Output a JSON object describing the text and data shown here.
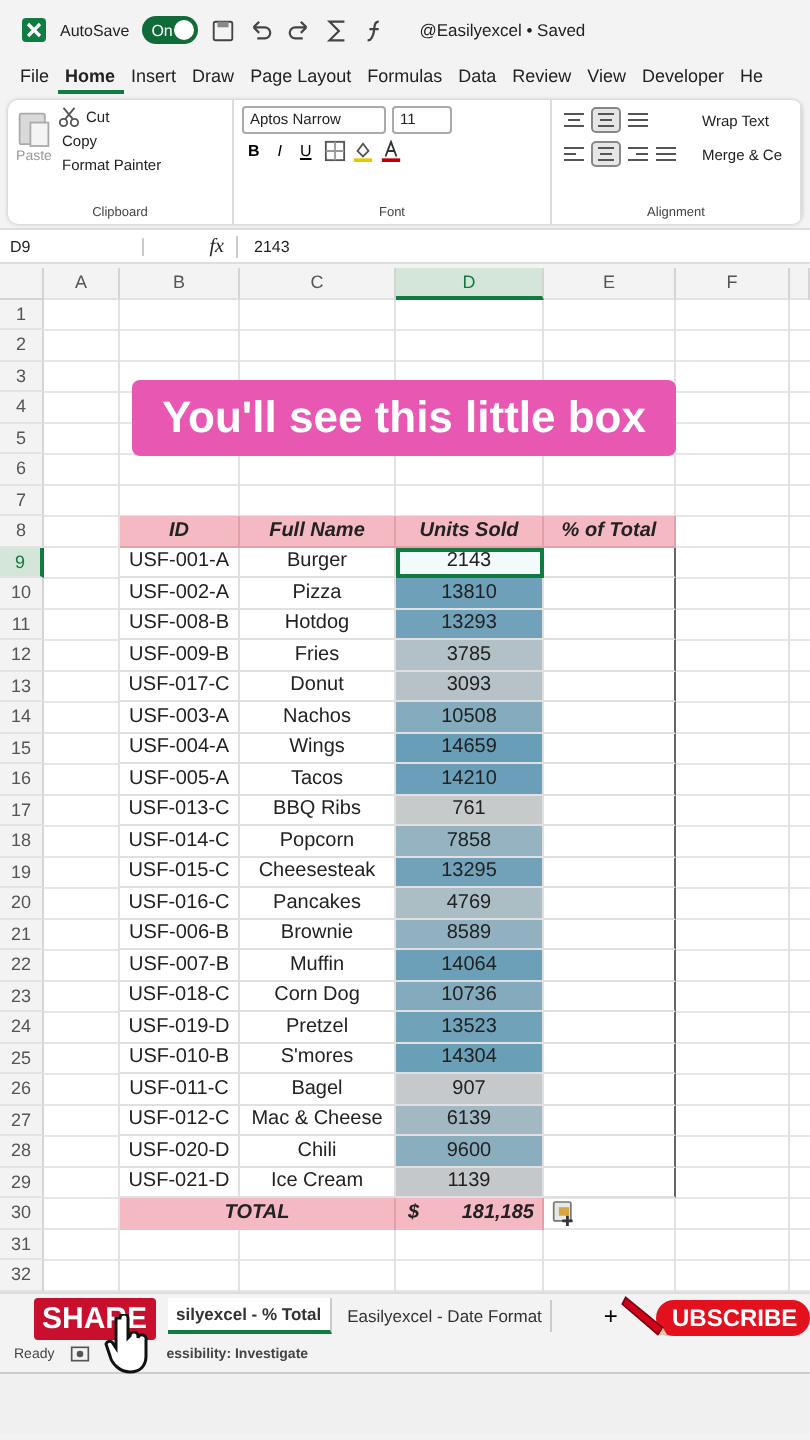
{
  "title_bar": {
    "autosave": "AutoSave",
    "autosave_on": true,
    "toggle_text": "On",
    "document": "@Easilyexcel • Saved"
  },
  "menu_tabs": [
    {
      "label": "File",
      "selected": false
    },
    {
      "label": "Home",
      "selected": true
    },
    {
      "label": "Insert",
      "selected": false
    },
    {
      "label": "Draw",
      "selected": false
    },
    {
      "label": "Page Layout",
      "selected": false
    },
    {
      "label": "Formulas",
      "selected": false
    },
    {
      "label": "Data",
      "selected": false
    },
    {
      "label": "Review",
      "selected": false
    },
    {
      "label": "View",
      "selected": false
    },
    {
      "label": "Developer",
      "selected": false
    },
    {
      "label": "He",
      "selected": false
    }
  ],
  "ribbon": {
    "clipboard": {
      "paste": "Paste",
      "cut": "Cut",
      "copy": "Copy",
      "format_painter": "Format Painter",
      "label": "Clipboard"
    },
    "font": {
      "name": "Aptos Narrow",
      "size": "11",
      "bold": "B",
      "italic": "I",
      "underline": "U",
      "label": "Font"
    },
    "alignment": {
      "wrap_text": "Wrap Text",
      "merge": "Merge & Ce",
      "label": "Alignment"
    }
  },
  "formula_bar": {
    "name_box": "D9",
    "fx": "fx",
    "value": "2143"
  },
  "columns": [
    {
      "label": "A",
      "selected": false
    },
    {
      "label": "B",
      "selected": false
    },
    {
      "label": "C",
      "selected": false
    },
    {
      "label": "D",
      "selected": true
    },
    {
      "label": "E",
      "selected": false
    },
    {
      "label": "F",
      "selected": false
    }
  ],
  "caption": "You'll see this little box",
  "grid_rows": [
    {
      "number": "1",
      "kind": "blank"
    },
    {
      "number": "2",
      "kind": "blank"
    },
    {
      "number": "3",
      "kind": "blank"
    },
    {
      "number": "4",
      "kind": "blank"
    },
    {
      "number": "5",
      "kind": "blank"
    },
    {
      "number": "6",
      "kind": "blank"
    },
    {
      "number": "7",
      "kind": "blank"
    },
    {
      "number": "8",
      "kind": "header",
      "cells": [
        "ID",
        "Full Name",
        "Units Sold",
        "% of Total"
      ]
    },
    {
      "number": "9",
      "kind": "data",
      "id": "USF-001-A",
      "name": "Burger",
      "units": "2143",
      "selected": true
    },
    {
      "number": "10",
      "kind": "data",
      "id": "USF-002-A",
      "name": "Pizza",
      "units": "13810",
      "selected": false
    },
    {
      "number": "11",
      "kind": "data",
      "id": "USF-008-B",
      "name": "Hotdog",
      "units": "13293",
      "selected": false
    },
    {
      "number": "12",
      "kind": "data",
      "id": "USF-009-B",
      "name": "Fries",
      "units": "3785",
      "selected": false
    },
    {
      "number": "13",
      "kind": "data",
      "id": "USF-017-C",
      "name": "Donut",
      "units": "3093",
      "selected": false
    },
    {
      "number": "14",
      "kind": "data",
      "id": "USF-003-A",
      "name": "Nachos",
      "units": "10508",
      "selected": false
    },
    {
      "number": "15",
      "kind": "data",
      "id": "USF-004-A",
      "name": "Wings",
      "units": "14659",
      "selected": false
    },
    {
      "number": "16",
      "kind": "data",
      "id": "USF-005-A",
      "name": "Tacos",
      "units": "14210",
      "selected": false
    },
    {
      "number": "17",
      "kind": "data",
      "id": "USF-013-C",
      "name": "BBQ Ribs",
      "units": "761",
      "selected": false
    },
    {
      "number": "18",
      "kind": "data",
      "id": "USF-014-C",
      "name": "Popcorn",
      "units": "7858",
      "selected": false
    },
    {
      "number": "19",
      "kind": "data",
      "id": "USF-015-C",
      "name": "Cheesesteak",
      "units": "13295",
      "selected": false
    },
    {
      "number": "20",
      "kind": "data",
      "id": "USF-016-C",
      "name": "Pancakes",
      "units": "4769",
      "selected": false
    },
    {
      "number": "21",
      "kind": "data",
      "id": "USF-006-B",
      "name": "Brownie",
      "units": "8589",
      "selected": false
    },
    {
      "number": "22",
      "kind": "data",
      "id": "USF-007-B",
      "name": "Muffin",
      "units": "14064",
      "selected": false
    },
    {
      "number": "23",
      "kind": "data",
      "id": "USF-018-C",
      "name": "Corn Dog",
      "units": "10736",
      "selected": false
    },
    {
      "number": "24",
      "kind": "data",
      "id": "USF-019-D",
      "name": "Pretzel",
      "units": "13523",
      "selected": false
    },
    {
      "number": "25",
      "kind": "data",
      "id": "USF-010-B",
      "name": "S'mores",
      "units": "14304",
      "selected": false
    },
    {
      "number": "26",
      "kind": "data",
      "id": "USF-011-C",
      "name": "Bagel",
      "units": "907",
      "selected": false
    },
    {
      "number": "27",
      "kind": "data",
      "id": "USF-012-C",
      "name": "Mac & Cheese",
      "units": "6139",
      "selected": false
    },
    {
      "number": "28",
      "kind": "data",
      "id": "USF-020-D",
      "name": "Chili",
      "units": "9600",
      "selected": false
    },
    {
      "number": "29",
      "kind": "data",
      "id": "USF-021-D",
      "name": "Ice Cream",
      "units": "1139",
      "selected": false
    },
    {
      "number": "30",
      "kind": "total",
      "label": "TOTAL",
      "currency": "$",
      "value": "181,185"
    },
    {
      "number": "31",
      "kind": "blank"
    },
    {
      "number": "32",
      "kind": "blank"
    }
  ],
  "sheet_tabs": [
    {
      "label": "silyexcel - % Total",
      "selected": true
    },
    {
      "label": "Easilyexcel - Date Format",
      "selected": false
    }
  ],
  "add_sheet": "+",
  "status_bar": {
    "ready": "Ready",
    "accessibility": "essibility: Investigate"
  },
  "stickers": {
    "share": "SHARE",
    "subscribe": "UBSCRIBE"
  }
}
